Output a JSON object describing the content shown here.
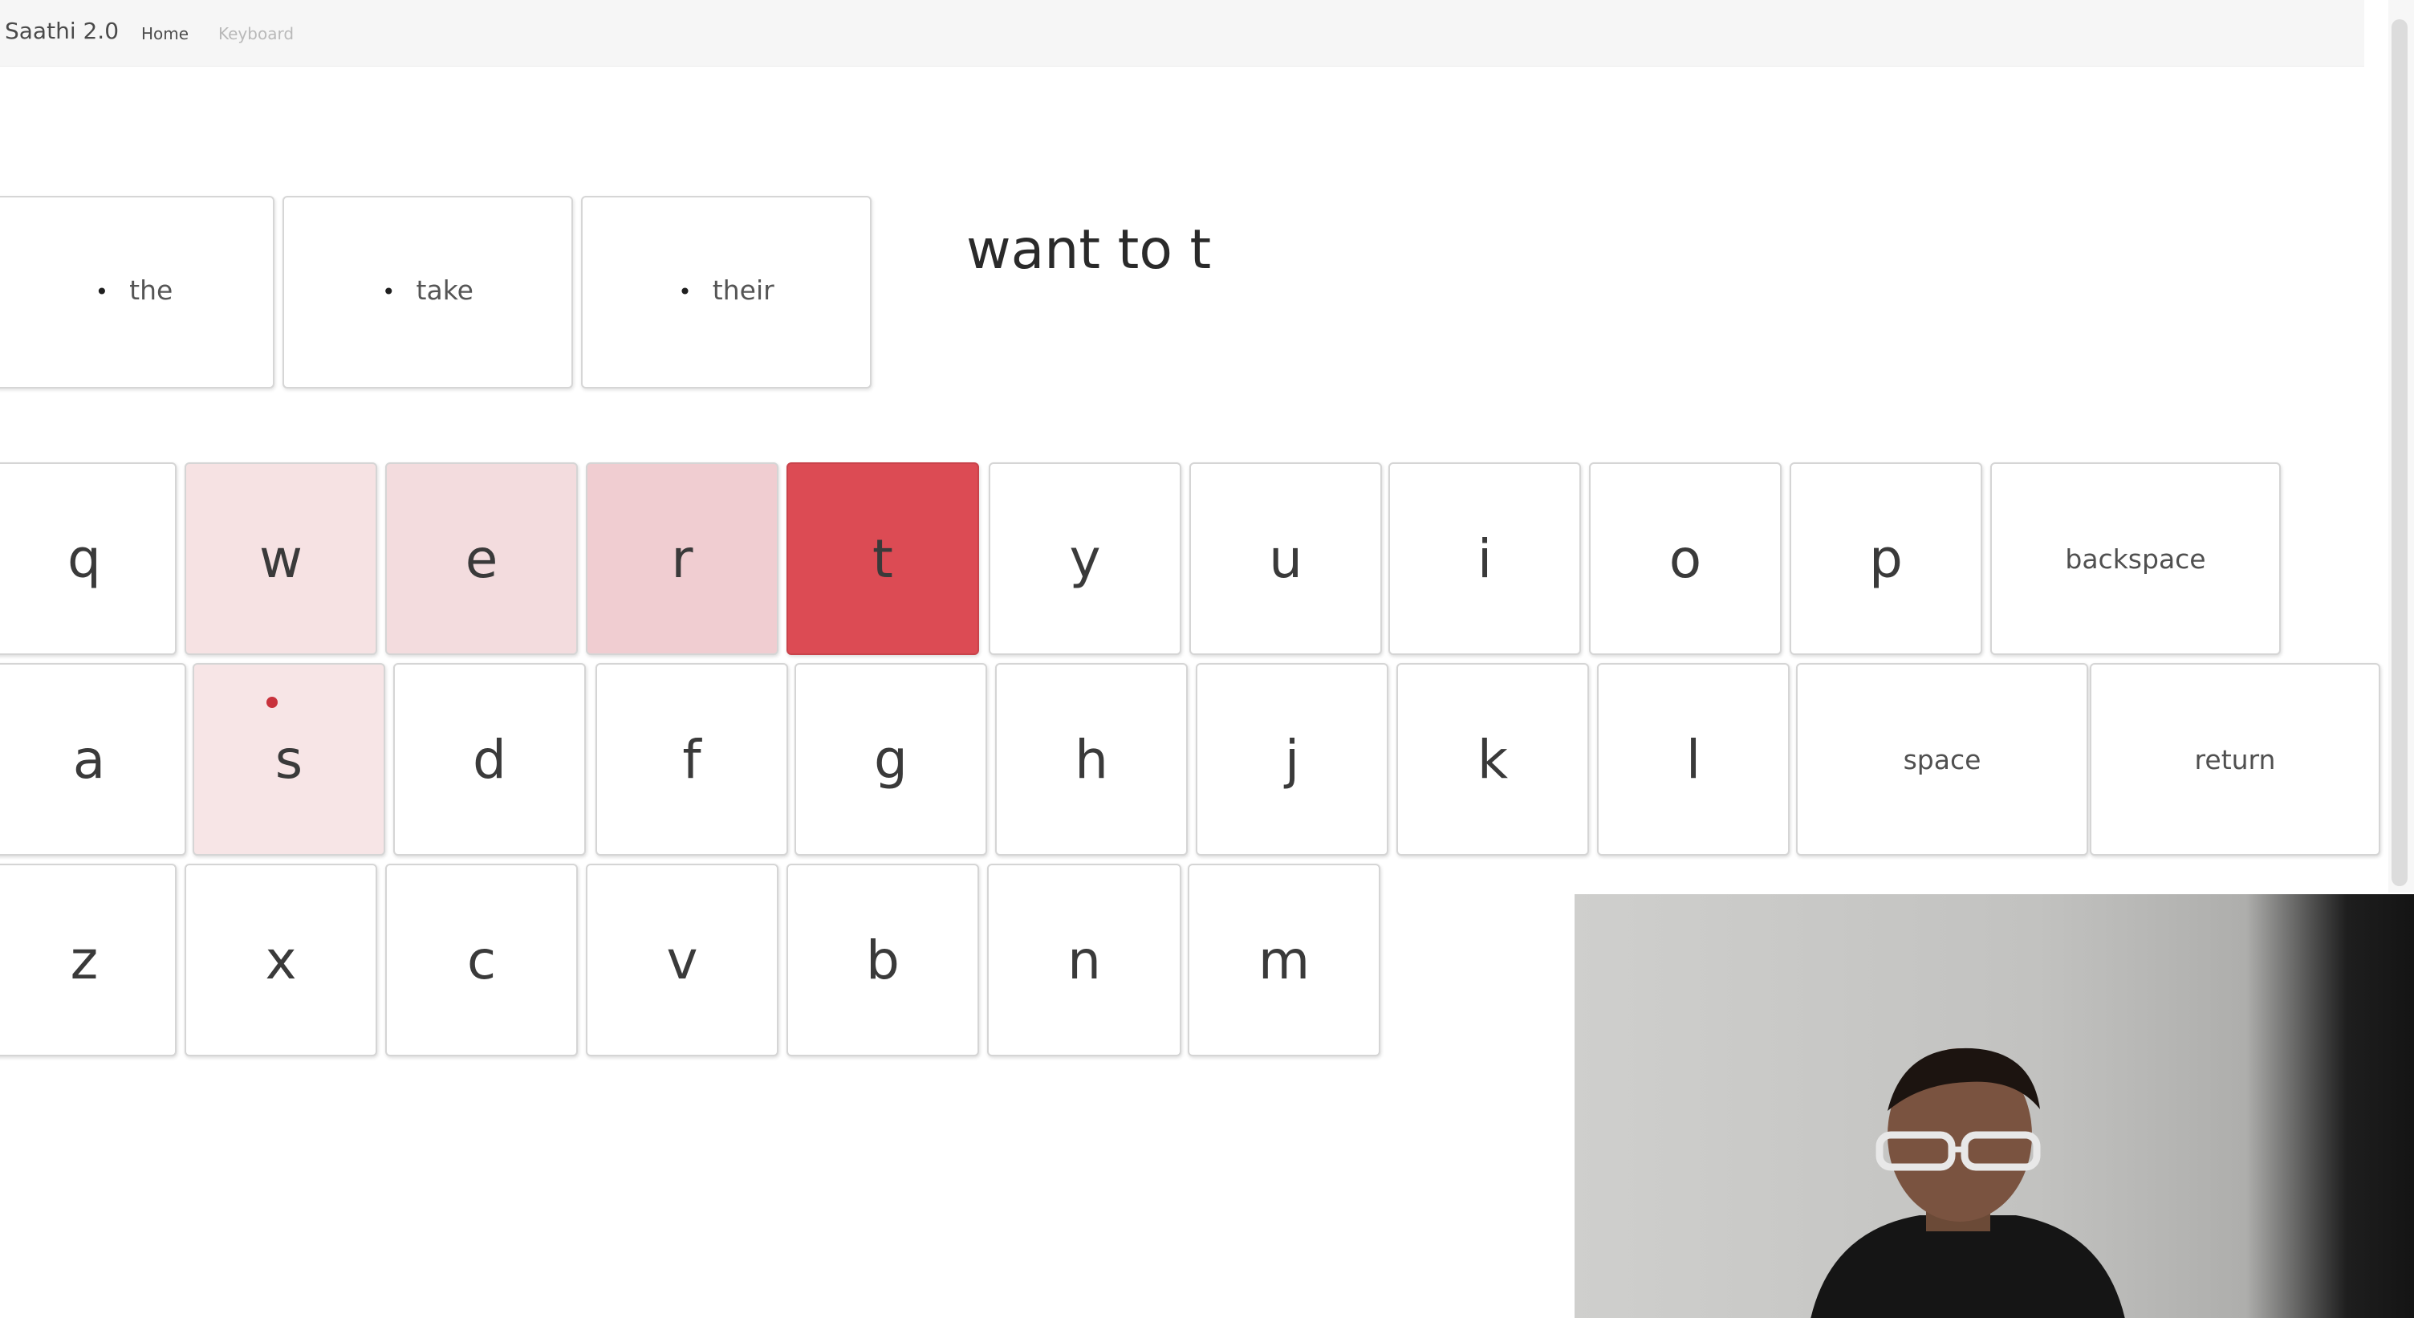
{
  "app": {
    "brand": "Saathi 2.0",
    "nav": {
      "home": "Home",
      "keyboard": "Keyboard"
    }
  },
  "suggestions": [
    "the",
    "take",
    "their"
  ],
  "typed_text": "want to t",
  "keyboard": {
    "row1": [
      "q",
      "w",
      "e",
      "r",
      "t",
      "y",
      "u",
      "i",
      "o",
      "p",
      "backspace"
    ],
    "row2": [
      "a",
      "s",
      "d",
      "f",
      "g",
      "h",
      "j",
      "k",
      "l",
      "space",
      "return"
    ],
    "row3": [
      "z",
      "x",
      "c",
      "v",
      "b",
      "n",
      "m"
    ]
  },
  "colors": {
    "active_key": "#dc4b54",
    "heat_strong": "#f0cdd1",
    "heat_medium": "#f3dcde",
    "heat_light": "#f6e2e3",
    "heat_faint": "#f7e5e6",
    "gaze_marker": "#c8323c"
  }
}
